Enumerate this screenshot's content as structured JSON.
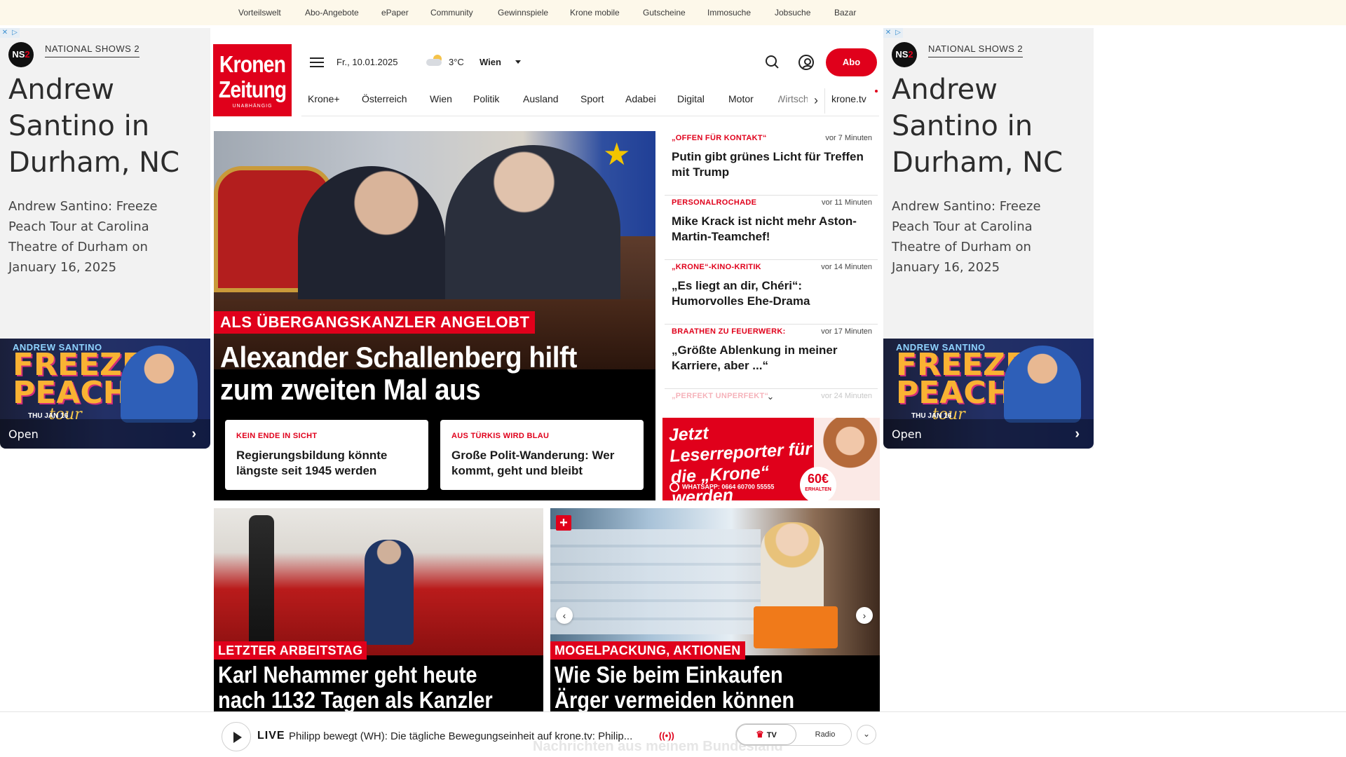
{
  "topbar": {
    "links": [
      "Vorteilswelt",
      "Abo-Angebote",
      "ePaper",
      "Community",
      "Gewinnspiele",
      "Krone mobile",
      "Gutscheine",
      "Immosuche",
      "Jobsuche",
      "Bazar"
    ]
  },
  "side_ad": {
    "adchoice_left": "✕",
    "adchoice_right": "▷",
    "logo_text": "NS",
    "logo_suffix": "2",
    "brand": "NATIONAL SHOWS 2",
    "headline": "Andrew Santino in Durham, NC",
    "description": "Andrew Santino: Freeze Peach Tour at Carolina Theatre of Durham on January 16, 2025",
    "banner_line1": "ANDREW SANTINO",
    "banner_line2": "FREEZE PEACH",
    "banner_line3": "tour",
    "banner_line4": "THU JAN 16",
    "open_label": "Open",
    "chevron": "›"
  },
  "header": {
    "logo_line1": "Kronen",
    "logo_line2": "Zeitung",
    "logo_line3": "UNABHÄNGIG",
    "date": "Fr., 10.01.2025",
    "temperature": "3°C",
    "city": "Wien",
    "abo_label": "Abo"
  },
  "nav": {
    "items": [
      "Krone+",
      "Österreich",
      "Wien",
      "Politik",
      "Ausland",
      "Sport",
      "Adabei",
      "Digital",
      "Motor",
      "Wirtschaft"
    ],
    "arrow": "›",
    "tv_label": "krone.tv"
  },
  "hero": {
    "kicker": "ALS ÜBERGANGSKANZLER ANGELOBT",
    "title": "Alexander Schallenberg hilft zum zweiten Mal aus",
    "star": "★",
    "subcards": [
      {
        "kicker": "KEIN ENDE IN SICHT",
        "title": "Regierungsbildung könnte längste seit 1945 werden"
      },
      {
        "kicker": "AUS TÜRKIS WIRD BLAU",
        "title": "Große Polit-Wanderung: Wer kommt, geht und bleibt"
      }
    ]
  },
  "ticker": [
    {
      "kicker": "„OFFEN FÜR KONTAKT“",
      "time": "vor 7 Minuten",
      "title": "Putin gibt grünes Licht für Treffen mit Trump"
    },
    {
      "kicker": "PERSONALROCHADE",
      "time": "vor 11 Minuten",
      "title": "Mike Krack ist nicht mehr Aston-Martin-Teamchef!"
    },
    {
      "kicker": "„KRONE“-KINO-KRITIK",
      "time": "vor 14 Minuten",
      "title": "„Es liegt an dir, Chéri“: Humorvolles Ehe-Drama"
    },
    {
      "kicker": "BRAATHEN ZU FEUERWERK:",
      "time": "vor 17 Minuten",
      "title": "„Größte Ablenkung in meiner Karriere, aber ...“"
    },
    {
      "kicker": "„PERFEKT UNPERFEKT“",
      "time": "vor 24 Minuten",
      "title": ""
    }
  ],
  "ticker_more": "⌄",
  "leserreporter": {
    "title": "Jetzt Leserreporter für die „Krone“ werden",
    "whatsapp": "WHATSAPP: 0664 60700 55555",
    "amount": "60€",
    "amount_label": "ERHALTEN"
  },
  "cards": [
    {
      "kicker": "LETZTER ARBEITSTAG",
      "title_line1": "Karl Nehammer geht heute",
      "title_line2": "nach 1132 Tagen als Kanzler"
    },
    {
      "kicker": "MOGELPACKUNG, AKTIONEN",
      "title_line1": "Wie Sie beim Einkaufen",
      "title_line2": "Ärger vermeiden können",
      "plus": "+",
      "prev": "‹",
      "next": "›"
    }
  ],
  "player": {
    "live_label": "LIVE",
    "title": "Philipp bewegt (WH): Die tägliche Bewegungseinheit auf krone.tv: Philip...",
    "broadcast_icon": "((•))",
    "tv_label": "TV",
    "tv_icon": "♛",
    "radio_label": "Radio",
    "expand": "⌄",
    "behind_text": "Nachrichten aus meinem Bundesland"
  }
}
